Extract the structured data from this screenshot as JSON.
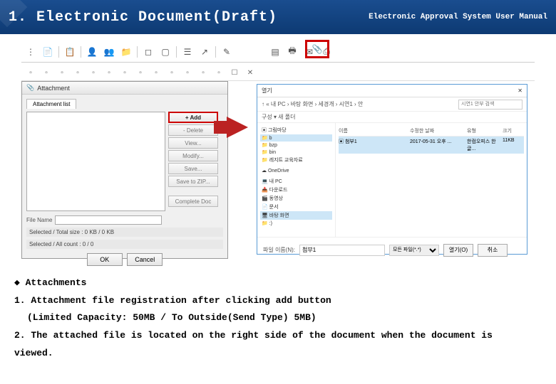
{
  "header": {
    "title": "1. Electronic Document(Draft)",
    "subtitle": "Electronic Approval System User Manual"
  },
  "attach_dialog": {
    "title": "Attachment",
    "tab": "Attachment list",
    "buttons": {
      "add": "+ Add",
      "delete": "- Delete",
      "view": "View...",
      "modify": "Modify...",
      "save": "Save...",
      "zip": "Save to ZIP...",
      "complete": "Complete Doc"
    },
    "file_name_label": "File Name",
    "status1": "Selected / Total size : 0 KB / 0 KB",
    "status2": "Selected / All count : 0 / 0",
    "ok": "OK",
    "cancel": "Cancel"
  },
  "open_dialog": {
    "title": "열기",
    "breadcrumb": "↑ « 내 PC › 바탕 화면 › 세경개 › 시연1 › 안",
    "search_placeholder": "시연1 안부 검색",
    "org_label": "구성 ▾   새 폴더",
    "tree": [
      "▣ 그림마당",
      "📁 b",
      "📁 bzp",
      "📁 bin",
      "📁 레지트 교육자료",
      "☁ OneDrive",
      "💻 내 PC",
      "📥 다운로드",
      "🎬 동영상",
      "📄 문서",
      "🖥 바탕 화면",
      "📁 :)"
    ],
    "columns": {
      "name": "이름",
      "date": "수정한 날짜",
      "type": "유형",
      "size": "크기"
    },
    "file": {
      "name": "▣ 첨부1",
      "date": "2017-05-31 오후 ...",
      "type": "한컴오피스 한글...",
      "size": "11KB"
    },
    "fn_label": "파일 이름(N):",
    "fn_value": "첨부1",
    "filter": "모든 파일(*.*)",
    "open_btn": "열기(O)",
    "cancel_btn": "취소"
  },
  "notes": {
    "heading": "◆ Attachments",
    "line1": "1. Attachment file registration after clicking add button",
    "line1b": "(Limited Capacity: 50MB / To Outside(Send Type) 5MB)",
    "line2": "2. The attached file is located on the right side of the document when the document is",
    "line2b": "viewed."
  }
}
